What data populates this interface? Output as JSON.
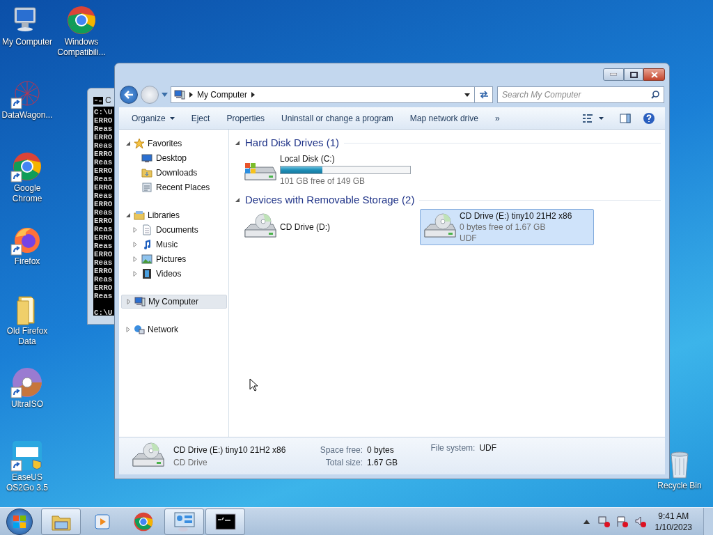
{
  "desktop_icons": [
    {
      "label": "My Computer",
      "kind": "computer",
      "shortcut": false
    },
    {
      "label": "Windows Compatibili...",
      "kind": "chrome",
      "shortcut": false
    },
    {
      "label": "DataWagon...",
      "kind": "graph",
      "shortcut": true
    },
    {
      "label": "Google Chrome",
      "kind": "chrome",
      "shortcut": true
    },
    {
      "label": "Firefox",
      "kind": "firefox",
      "shortcut": true
    },
    {
      "label": "Old Firefox Data",
      "kind": "folder",
      "shortcut": false
    },
    {
      "label": "UltraISO",
      "kind": "disc",
      "shortcut": true
    },
    {
      "label": "EaseUS OS2Go 3.5",
      "kind": "app",
      "shortcut": true
    },
    {
      "label": "Recycle Bin",
      "kind": "bin",
      "shortcut": false
    }
  ],
  "console_window": {
    "title": "C",
    "lines": [
      "C:\\U",
      "ERRO",
      "Reas",
      "ERRO",
      "Reas",
      "ERRO",
      "Reas",
      "ERRO",
      "Reas",
      "ERRO",
      "Reas",
      "ERRO",
      "Reas",
      "ERRO",
      "Reas",
      "ERRO",
      "Reas",
      "ERRO",
      "Reas",
      "ERRO",
      "Reas",
      "ERRO",
      "Reas"
    ],
    "prompt": "C:\\U"
  },
  "explorer": {
    "address": [
      "My Computer"
    ],
    "search": {
      "placeholder": "Search My Computer"
    },
    "toolbar": [
      {
        "label": "Organize",
        "dropdown": true
      },
      {
        "label": "Eject",
        "dropdown": false
      },
      {
        "label": "Properties",
        "dropdown": false
      },
      {
        "label": "Uninstall or change a program",
        "dropdown": false
      },
      {
        "label": "Map network drive",
        "dropdown": false
      },
      {
        "label": "»",
        "dropdown": false
      }
    ],
    "nav": [
      {
        "label": "Favorites",
        "kind": "star",
        "expanded": true,
        "selected": false,
        "children": [
          {
            "label": "Desktop",
            "kind": "desktop",
            "selected": false
          },
          {
            "label": "Downloads",
            "kind": "folder",
            "selected": false
          },
          {
            "label": "Recent Places",
            "kind": "recent",
            "selected": false
          }
        ]
      },
      {
        "label": "Libraries",
        "kind": "library",
        "expanded": true,
        "selected": false,
        "children": [
          {
            "label": "Documents",
            "kind": "document",
            "selected": false,
            "expanded": false
          },
          {
            "label": "Music",
            "kind": "music",
            "selected": false,
            "expanded": false
          },
          {
            "label": "Pictures",
            "kind": "picture",
            "selected": false,
            "expanded": false
          },
          {
            "label": "Videos",
            "kind": "video",
            "selected": false,
            "expanded": false
          }
        ]
      },
      {
        "label": "My Computer",
        "kind": "computer",
        "expanded": false,
        "selected": true
      },
      {
        "label": "Network",
        "kind": "network",
        "expanded": false,
        "selected": false
      }
    ],
    "groups": [
      {
        "title": "Hard Disk Drives (1)",
        "expanded": true,
        "items": [
          {
            "name": "Local Disk (C:)",
            "kind": "disk",
            "level": 0.32,
            "details": [
              "101 GB free of 149 GB"
            ],
            "selected": false
          }
        ]
      },
      {
        "title": "Devices with Removable Storage (2)",
        "expanded": true,
        "items": [
          {
            "name": "CD Drive (D:)",
            "kind": "cd",
            "selected": false
          },
          {
            "name": "CD Drive (E:) tiny10 21H2 x86",
            "kind": "cd",
            "details": [
              "0 bytes free of 1.67 GB",
              "UDF"
            ],
            "selected": true
          }
        ]
      }
    ],
    "details_pane": {
      "name": "CD Drive (E:) tiny10 21H2 x86",
      "type": "CD Drive",
      "fields": [
        {
          "label": "Space free:",
          "value": "0 bytes"
        },
        {
          "label": "Total size:",
          "value": "1.67 GB"
        },
        {
          "label": "File system:",
          "value": "UDF"
        }
      ]
    }
  },
  "taskbar": {
    "buttons": [
      {
        "kind": "explorer",
        "open": true
      },
      {
        "kind": "media",
        "open": false
      },
      {
        "kind": "chrome",
        "open": false
      },
      {
        "kind": "control",
        "open": true
      },
      {
        "kind": "console",
        "open": true
      }
    ],
    "clock": {
      "time": "9:41 AM",
      "date": "1/10/2023"
    }
  }
}
